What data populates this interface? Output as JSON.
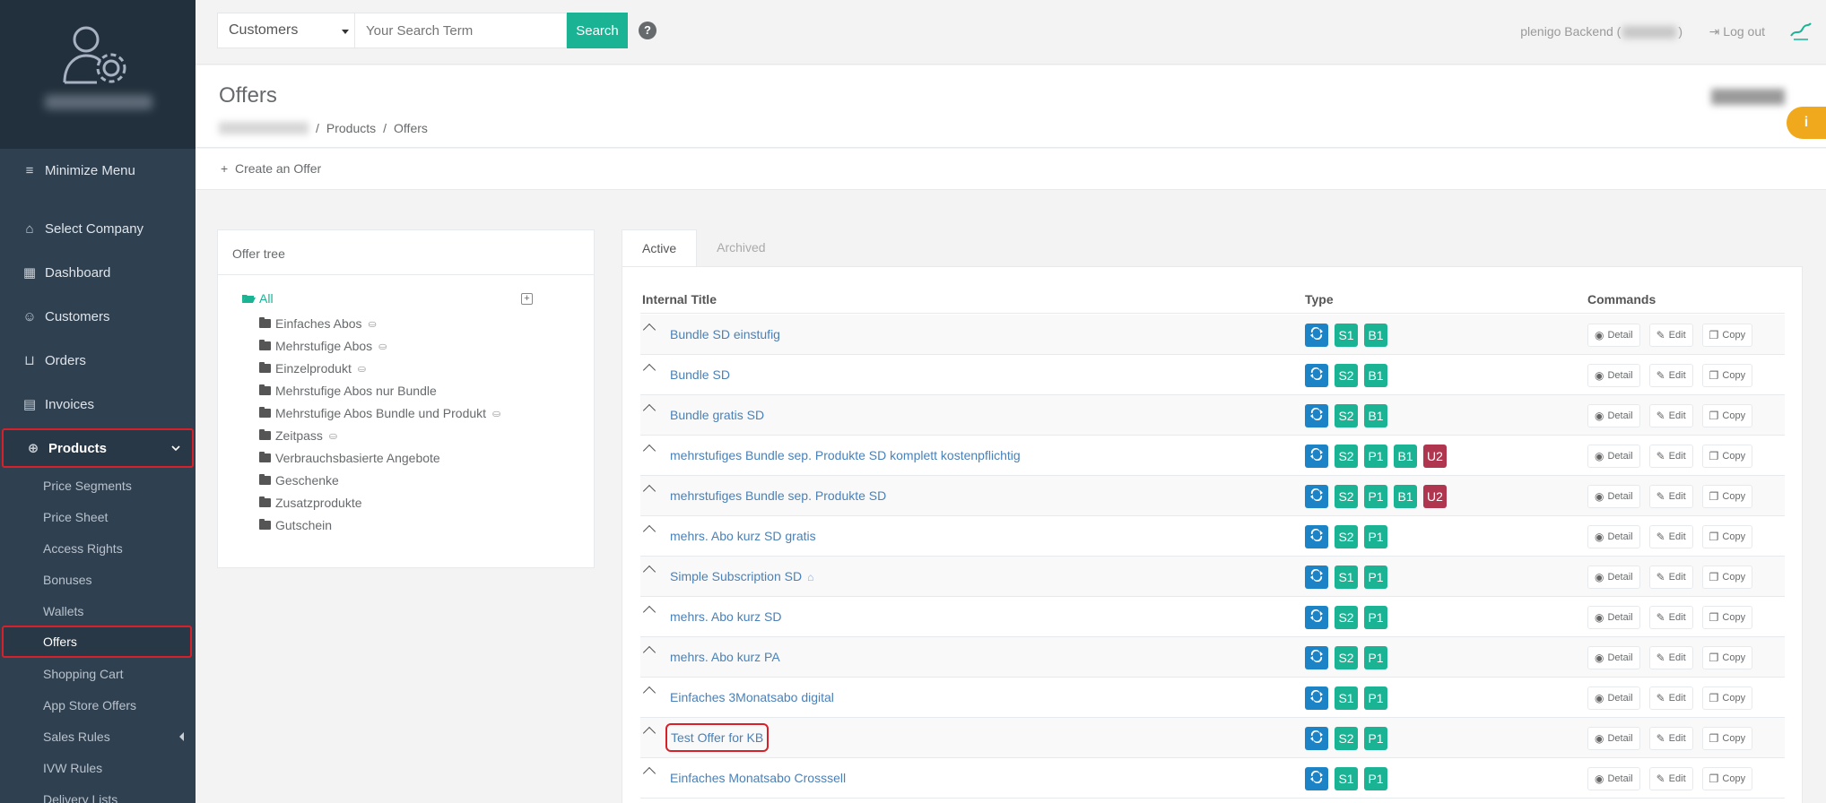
{
  "topbar": {
    "search_scope": "Customers",
    "search_placeholder": "Your Search Term",
    "search_button": "Search",
    "help": "?",
    "backend_label": "plenigo Backend (",
    "backend_label_end": ")",
    "logout": "Log out"
  },
  "sidebar": {
    "items": [
      {
        "label": "Minimize Menu"
      },
      {
        "label": "Select Company"
      },
      {
        "label": "Dashboard"
      },
      {
        "label": "Customers"
      },
      {
        "label": "Orders"
      },
      {
        "label": "Invoices"
      },
      {
        "label": "Products"
      }
    ],
    "sub_items": [
      {
        "label": "Price Segments"
      },
      {
        "label": "Price Sheet"
      },
      {
        "label": "Access Rights"
      },
      {
        "label": "Bonuses"
      },
      {
        "label": "Wallets"
      },
      {
        "label": "Offers"
      },
      {
        "label": "Shopping Cart"
      },
      {
        "label": "App Store Offers"
      },
      {
        "label": "Sales Rules"
      },
      {
        "label": "IVW Rules"
      },
      {
        "label": "Delivery Lists"
      }
    ]
  },
  "heading": {
    "title": "Offers",
    "breadcrumb": [
      "Products",
      "Offers"
    ],
    "separator": "/",
    "info": "i"
  },
  "actions": {
    "create_offer": "Create an Offer"
  },
  "tree": {
    "title": "Offer tree",
    "root": "All",
    "nodes": [
      {
        "label": "Einfaches Abos",
        "bag": true
      },
      {
        "label": "Mehrstufige Abos",
        "bag": true
      },
      {
        "label": "Einzelprodukt",
        "bag": true
      },
      {
        "label": "Mehrstufige Abos nur Bundle",
        "bag": false
      },
      {
        "label": "Mehrstufige Abos Bundle und Produkt",
        "bag": true
      },
      {
        "label": "Zeitpass",
        "bag": true
      },
      {
        "label": "Verbrauchsbasierte Angebote",
        "bag": false
      },
      {
        "label": "Geschenke",
        "bag": false
      },
      {
        "label": "Zusatzprodukte",
        "bag": false
      },
      {
        "label": "Gutschein",
        "bag": false
      }
    ]
  },
  "tabs": [
    "Active",
    "Archived"
  ],
  "table": {
    "headers": [
      "Internal Title",
      "Type",
      "Commands"
    ],
    "commands": [
      "Detail",
      "Edit",
      "Copy"
    ],
    "rows": [
      {
        "title": "Bundle SD einstufig",
        "badges": [
          "S1",
          "B1"
        ]
      },
      {
        "title": "Bundle SD",
        "badges": [
          "S2",
          "B1"
        ]
      },
      {
        "title": "Bundle gratis SD",
        "badges": [
          "S2",
          "B1"
        ]
      },
      {
        "title": "mehrstufiges Bundle sep. Produkte SD komplett kostenpflichtig",
        "badges": [
          "S2",
          "P1",
          "B1",
          "U2"
        ]
      },
      {
        "title": "mehrstufiges Bundle sep. Produkte SD",
        "badges": [
          "S2",
          "P1",
          "B1",
          "U2"
        ]
      },
      {
        "title": "mehrs. Abo kurz SD gratis",
        "badges": [
          "S2",
          "P1"
        ]
      },
      {
        "title": "Simple Subscription SD",
        "badges": [
          "S1",
          "P1"
        ],
        "tag": true
      },
      {
        "title": "mehrs. Abo kurz SD",
        "badges": [
          "S2",
          "P1"
        ]
      },
      {
        "title": "mehrs. Abo kurz PA",
        "badges": [
          "S2",
          "P1"
        ]
      },
      {
        "title": "Einfaches 3Monatsabo digital",
        "badges": [
          "S1",
          "P1"
        ]
      },
      {
        "title": "Test Offer for KB",
        "badges": [
          "S2",
          "P1"
        ],
        "highlight": true
      },
      {
        "title": "Einfaches Monatsabo Crosssell",
        "badges": [
          "S1",
          "P1"
        ]
      }
    ]
  }
}
